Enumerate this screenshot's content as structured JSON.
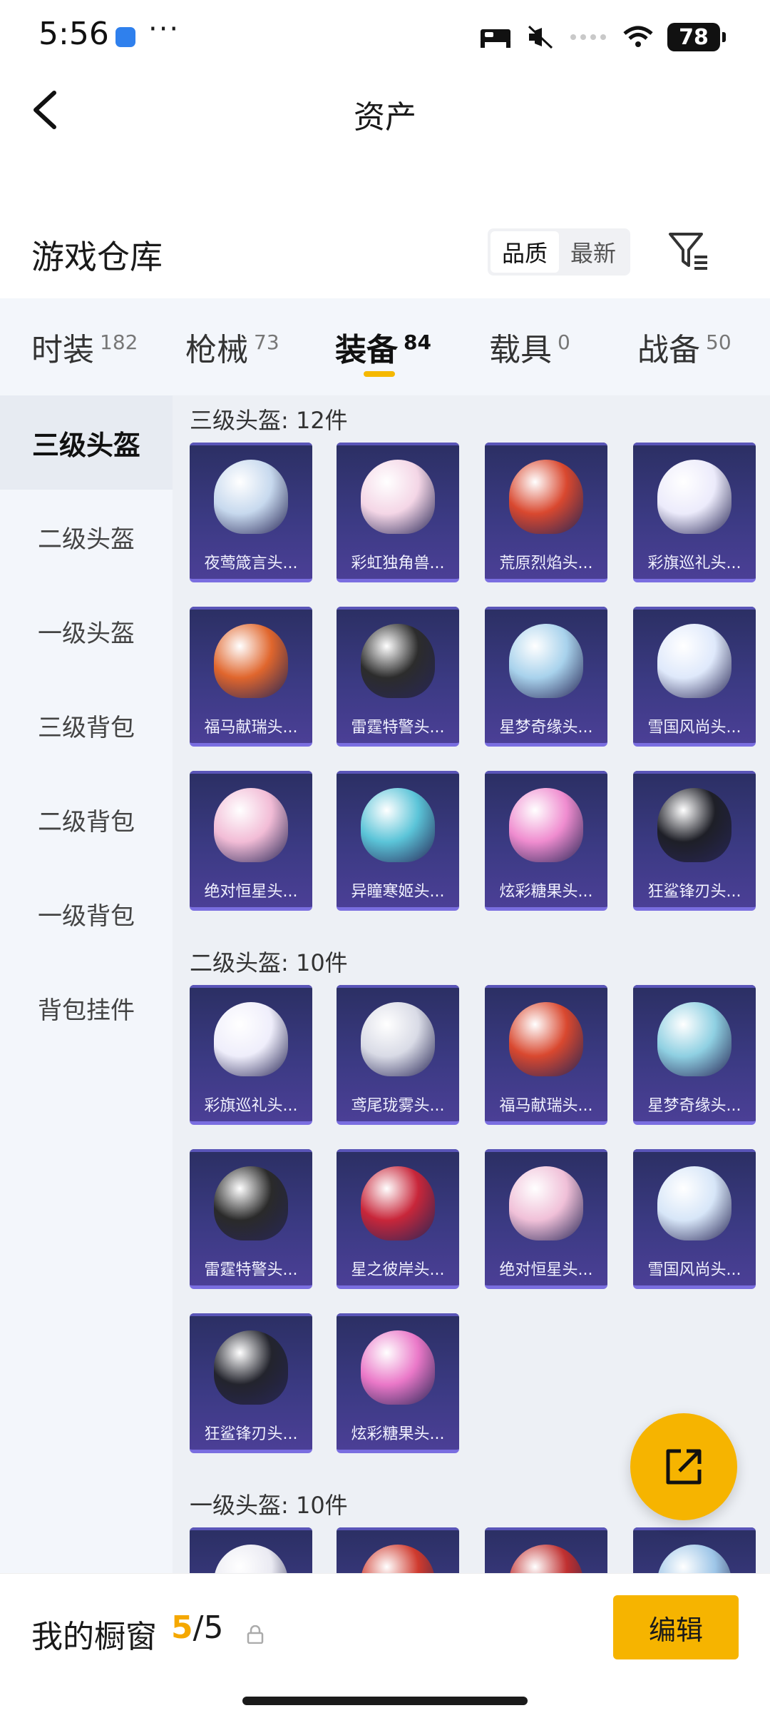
{
  "status_bar": {
    "time": "5:56",
    "more": "···",
    "battery": "78"
  },
  "header": {
    "title": "资产"
  },
  "warehouse": {
    "title": "游戏仓库",
    "sort_options": [
      "品质",
      "最新"
    ],
    "active_sort": "品质"
  },
  "tabs": [
    {
      "label": "时装",
      "count": "182"
    },
    {
      "label": "枪械",
      "count": "73"
    },
    {
      "label": "装备",
      "count": "84",
      "active": true
    },
    {
      "label": "载具",
      "count": "0"
    },
    {
      "label": "战备",
      "count": "50"
    }
  ],
  "side_menu": [
    {
      "label": "三级头盔",
      "active": true
    },
    {
      "label": "二级头盔"
    },
    {
      "label": "一级头盔"
    },
    {
      "label": "三级背包"
    },
    {
      "label": "二级背包"
    },
    {
      "label": "一级背包"
    },
    {
      "label": "背包挂件"
    }
  ],
  "groups": [
    {
      "title": "三级头盔: 12件",
      "items": [
        {
          "name": "夜莺箴言头...",
          "color": "#c7d9ee"
        },
        {
          "name": "彩虹独角兽...",
          "color": "#f4d6e6"
        },
        {
          "name": "荒原烈焰头...",
          "color": "#d9482f"
        },
        {
          "name": "彩旗巡礼头...",
          "color": "#ecebfb"
        },
        {
          "name": "福马献瑞头...",
          "color": "#e0662d"
        },
        {
          "name": "雷霆特警头...",
          "color": "#2c2c2c"
        },
        {
          "name": "星梦奇缘头...",
          "color": "#a8d2ec"
        },
        {
          "name": "雪国风尚头...",
          "color": "#dfe9fb"
        },
        {
          "name": "绝对恒星头...",
          "color": "#f2bcd6"
        },
        {
          "name": "异瞳寒姬头...",
          "color": "#5bc4d8"
        },
        {
          "name": "炫彩糖果头...",
          "color": "#ef8ccf"
        },
        {
          "name": "狂鲨锋刃头...",
          "color": "#1e1f27"
        }
      ]
    },
    {
      "title": "二级头盔: 10件",
      "items": [
        {
          "name": "彩旗巡礼头...",
          "color": "#efeefb"
        },
        {
          "name": "鸢尾珑雾头...",
          "color": "#d9dbe6"
        },
        {
          "name": "福马献瑞头...",
          "color": "#d9482f"
        },
        {
          "name": "星梦奇缘头...",
          "color": "#8fd0e2"
        },
        {
          "name": "雷霆特警头...",
          "color": "#2a2a2a"
        },
        {
          "name": "星之彼岸头...",
          "color": "#c8263a"
        },
        {
          "name": "绝对恒星头...",
          "color": "#f0c0d8"
        },
        {
          "name": "雪国风尚头...",
          "color": "#d7e6f8"
        },
        {
          "name": "狂鲨锋刃头...",
          "color": "#23242d"
        },
        {
          "name": "炫彩糖果头...",
          "color": "#ea78c8"
        }
      ]
    },
    {
      "title": "一级头盔: 10件",
      "items": [
        {
          "name": "",
          "color": "#eaeaf2"
        },
        {
          "name": "",
          "color": "#cf3a2e"
        },
        {
          "name": "",
          "color": "#c03030"
        },
        {
          "name": "",
          "color": "#9ec6e8"
        }
      ]
    }
  ],
  "bottom_bar": {
    "label": "我的橱窗",
    "count_current": "5",
    "count_total": "/5",
    "edit": "编辑"
  }
}
